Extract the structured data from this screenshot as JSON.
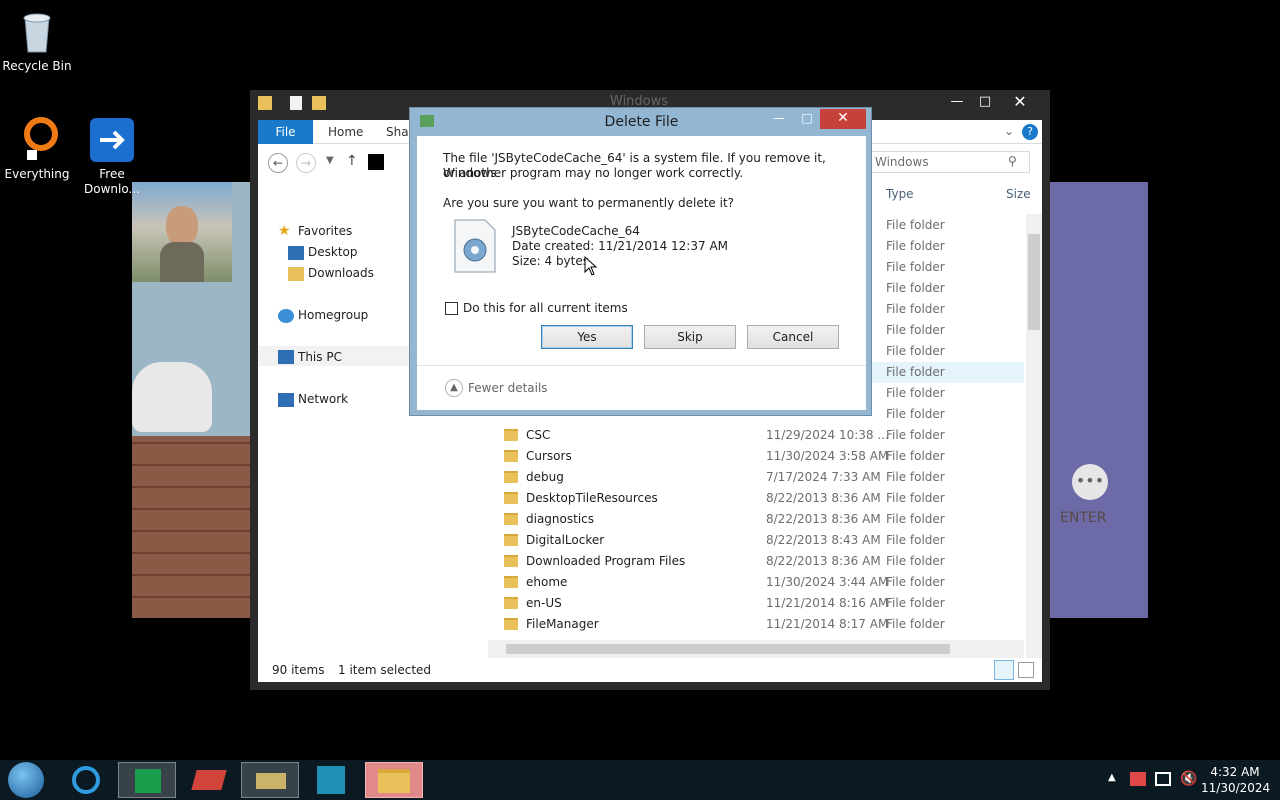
{
  "desktop": {
    "icons": [
      {
        "label": "Recycle Bin",
        "icon": "recycle-bin-icon"
      },
      {
        "label": "Everything",
        "icon": "everything-icon"
      },
      {
        "label": "Free Downlo...",
        "icon": "free-download-manager-icon"
      }
    ]
  },
  "wallpaper": {
    "enter_label": "ENTER"
  },
  "explorer": {
    "title": "Windows",
    "tabs": [
      "File",
      "Home",
      "Shar"
    ],
    "search_placeholder": "Windows",
    "nav": {
      "favorites": "Favorites",
      "desktop": "Desktop",
      "downloads": "Downloads",
      "homegroup": "Homegroup",
      "thispc": "This PC",
      "network": "Network"
    },
    "columns": {
      "type": "Type",
      "size": "Size"
    },
    "rows_top_types": [
      "File folder",
      "File folder",
      "File folder",
      "File folder",
      "File folder",
      "File folder",
      "File folder",
      "File folder",
      "File folder",
      "File folder"
    ],
    "rows": [
      {
        "name": "CSC",
        "date": "11/29/2024 10:38 ...",
        "type": "File folder"
      },
      {
        "name": "Cursors",
        "date": "11/30/2024 3:58 AM",
        "type": "File folder"
      },
      {
        "name": "debug",
        "date": "7/17/2024 7:33 AM",
        "type": "File folder"
      },
      {
        "name": "DesktopTileResources",
        "date": "8/22/2013 8:36 AM",
        "type": "File folder"
      },
      {
        "name": "diagnostics",
        "date": "8/22/2013 8:36 AM",
        "type": "File folder"
      },
      {
        "name": "DigitalLocker",
        "date": "8/22/2013 8:43 AM",
        "type": "File folder"
      },
      {
        "name": "Downloaded Program Files",
        "date": "8/22/2013 8:36 AM",
        "type": "File folder"
      },
      {
        "name": "ehome",
        "date": "11/30/2024 3:44 AM",
        "type": "File folder"
      },
      {
        "name": "en-US",
        "date": "11/21/2014 8:16 AM",
        "type": "File folder"
      },
      {
        "name": "FileManager",
        "date": "11/21/2014 8:17 AM",
        "type": "File folder"
      }
    ],
    "status": {
      "items": "90 items",
      "selected": "1 item selected"
    }
  },
  "dialog": {
    "title": "Delete File",
    "message_line1": "The file 'JSByteCodeCache_64' is a system file. If you remove it, Windows",
    "message_line2": "or another program may no longer work correctly.",
    "question": "Are you sure you want to permanently delete it?",
    "file_name": "JSByteCodeCache_64",
    "date_created": "Date created: 11/21/2014 12:37 AM",
    "size": "Size: 4 bytes",
    "checkbox_label": "Do this for all current items",
    "yes": "Yes",
    "skip": "Skip",
    "cancel": "Cancel",
    "fewer_details": "Fewer details"
  },
  "taskbar": {
    "time": "4:32 AM",
    "date": "11/30/2024"
  }
}
